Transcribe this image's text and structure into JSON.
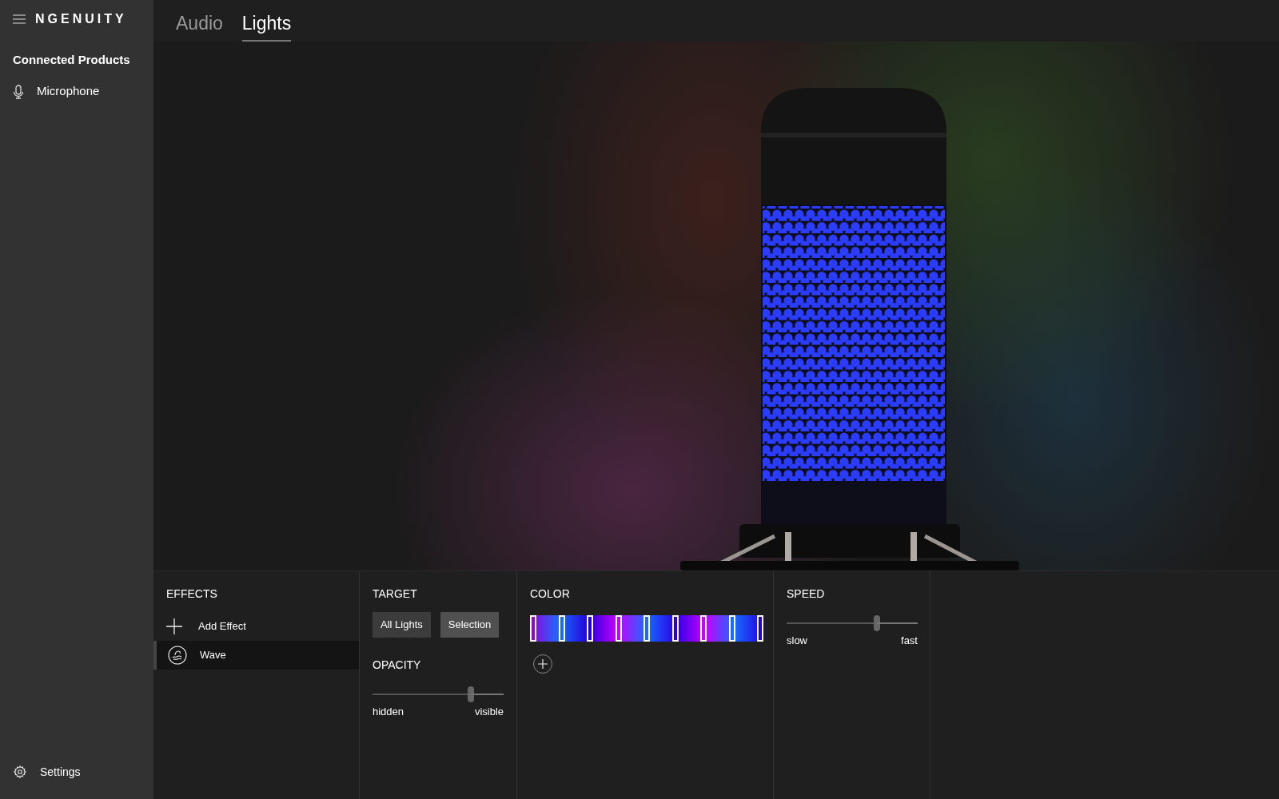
{
  "app": {
    "title": "NGENUITY"
  },
  "sidebar": {
    "heading": "Connected Products",
    "items": [
      {
        "label": "Microphone",
        "selected": false
      }
    ],
    "footer": "Settings"
  },
  "tabs": [
    {
      "label": "Audio",
      "selected": false
    },
    {
      "label": "Lights",
      "selected": true
    }
  ],
  "effects": {
    "heading": "EFFECTS",
    "add_label": "Add Effect",
    "items": [
      {
        "label": "Wave",
        "selected": true
      }
    ]
  },
  "target": {
    "heading": "TARGET",
    "buttons": [
      {
        "label": "All Lights",
        "selected": false
      },
      {
        "label": "Selection",
        "selected": true
      }
    ]
  },
  "opacity": {
    "heading": "OPACITY",
    "level": 0.75,
    "min_label": "hidden",
    "max_label": "visible"
  },
  "color": {
    "heading": "COLOR",
    "stops": [
      {
        "color": "#9a00d8"
      },
      {
        "color": "#1a6cff"
      },
      {
        "color": "#2400d8"
      },
      {
        "color": "#c800ff"
      },
      {
        "color": "#1a6cff"
      },
      {
        "color": "#2a00e6"
      },
      {
        "color": "#c800ff"
      },
      {
        "color": "#1a6cff"
      },
      {
        "color": "#2400e0"
      }
    ]
  },
  "speed": {
    "heading": "SPEED",
    "level": 0.69,
    "min_label": "slow",
    "max_label": "fast"
  }
}
